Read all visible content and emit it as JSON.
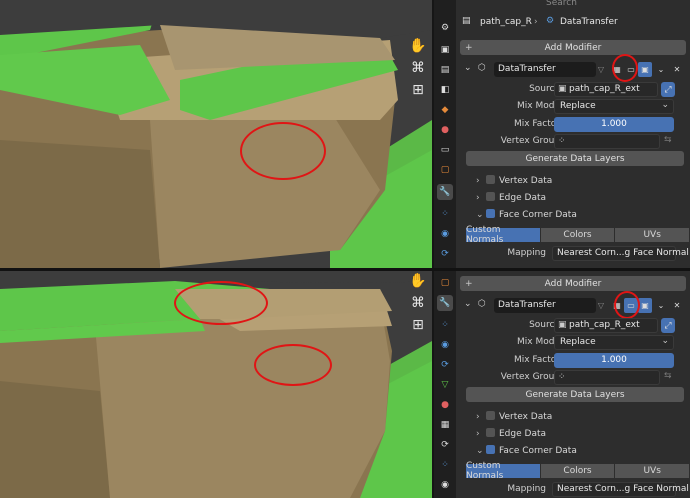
{
  "breadcrumb": {
    "object": "path_cap_R",
    "modifier": "DataTransfer",
    "search_placeholder": "Search"
  },
  "add_modifier_label": "Add Modifier",
  "modifier": {
    "name": "DataTransfer",
    "source_label": "Source",
    "source_value": "path_cap_R_ext",
    "mix_mode_label": "Mix Mode",
    "mix_mode_value": "Replace",
    "mix_factor_label": "Mix Factor",
    "mix_factor_value": "1.000",
    "vertex_group_label": "Vertex Group",
    "generate_label": "Generate Data Layers",
    "vertex_data_label": "Vertex Data",
    "edge_data_label": "Edge Data",
    "face_corner_label": "Face Corner Data",
    "tabs": [
      "Custom Normals",
      "Colors",
      "UVs"
    ],
    "mapping_label": "Mapping",
    "mapping_value": "Nearest Corn...g Face Normal"
  },
  "icons": {
    "viewport_gizmos": [
      "hand-icon",
      "camera-icon",
      "grid-icon"
    ],
    "property_tabs": [
      "tool-icon",
      "render-icon",
      "output-icon",
      "view-layer-icon",
      "scene-icon",
      "world-icon",
      "collection-icon",
      "object-icon",
      "modifier-icon",
      "particles-icon",
      "physics-icon",
      "constraints-icon",
      "data-icon"
    ]
  },
  "colors": {
    "accent_blue": "#4772b3",
    "annotation_red": "#e01515",
    "grass_green": "#5ec64a",
    "rock_tan": "#8a7550"
  }
}
